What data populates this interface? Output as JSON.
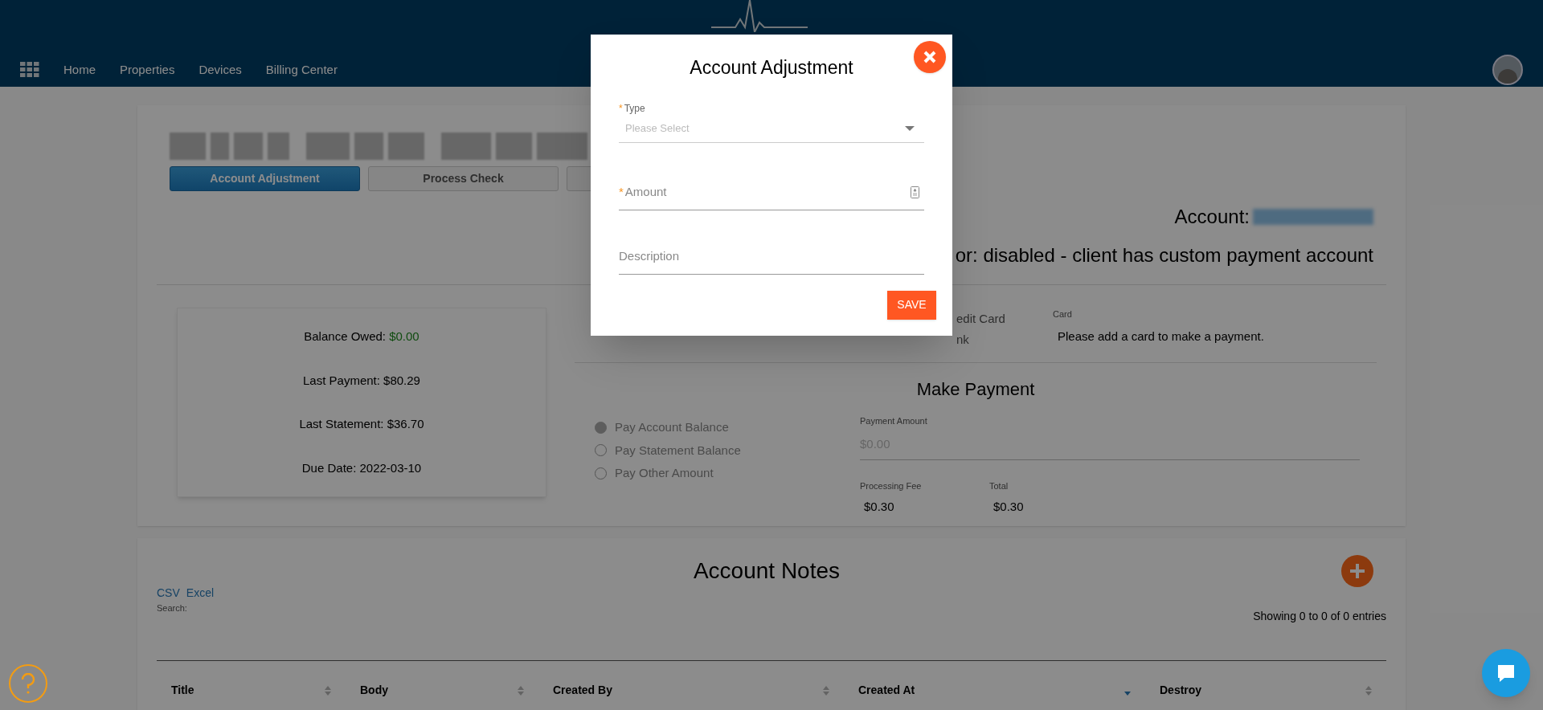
{
  "header": {
    "nav": [
      {
        "label": "Home"
      },
      {
        "label": "Properties"
      },
      {
        "label": "Devices"
      },
      {
        "label": "Billing Center"
      }
    ]
  },
  "account_card": {
    "action_buttons": [
      {
        "label": "Account Adjustment",
        "selected": true
      },
      {
        "label": "Process Check",
        "selected": false
      },
      {
        "selected": false
      }
    ],
    "account_label": "Account:",
    "processor_status": "or: disabled - client has custom payment account",
    "summary": [
      {
        "label": "Balance Owed:",
        "value": "$0.00",
        "kind": "positive"
      },
      {
        "label": "Last Payment:",
        "value": "$80.29",
        "kind": "plain"
      },
      {
        "label": "Last Statement:",
        "value": "$36.70",
        "kind": "plain"
      },
      {
        "label": "Due Date:",
        "value": "2022-03-10",
        "kind": "plain"
      }
    ],
    "payment_methods": [
      {
        "label": "edit Card"
      },
      {
        "label": "nk"
      }
    ],
    "card": {
      "label": "Card",
      "message": "Please add a card to make a payment."
    },
    "make_payment": {
      "title": "Make Payment",
      "options": [
        {
          "label": "Pay Account Balance",
          "selected": true
        },
        {
          "label": "Pay Statement Balance",
          "selected": false
        },
        {
          "label": "Pay Other Amount",
          "selected": false
        }
      ],
      "payment_amount": {
        "label": "Payment Amount",
        "placeholder": "$0.00"
      },
      "processing_fee": {
        "label": "Processing Fee",
        "value": "$0.30"
      },
      "total": {
        "label": "Total",
        "value": "$0.30"
      }
    }
  },
  "notes": {
    "title": "Account Notes",
    "exports": [
      "CSV",
      "Excel"
    ],
    "search_label": "Search:",
    "info": "Showing 0 to 0 of 0 entries",
    "columns": [
      {
        "label": "Title",
        "sorted_descending": false
      },
      {
        "label": "Body",
        "sorted_descending": false
      },
      {
        "label": "Created By",
        "sorted_descending": false
      },
      {
        "label": "Created At",
        "sorted_descending": true
      },
      {
        "label": "Destroy",
        "sorted_descending": false
      }
    ]
  },
  "modal": {
    "title": "Account Adjustment",
    "fields": [
      {
        "kind": "select",
        "label": "Type",
        "required": true,
        "placeholder": "Please Select"
      },
      {
        "kind": "number",
        "label": "Amount",
        "required": true
      },
      {
        "kind": "text",
        "label": "Description",
        "required": false
      }
    ],
    "required_marker": "*",
    "save_label": "SAVE"
  }
}
